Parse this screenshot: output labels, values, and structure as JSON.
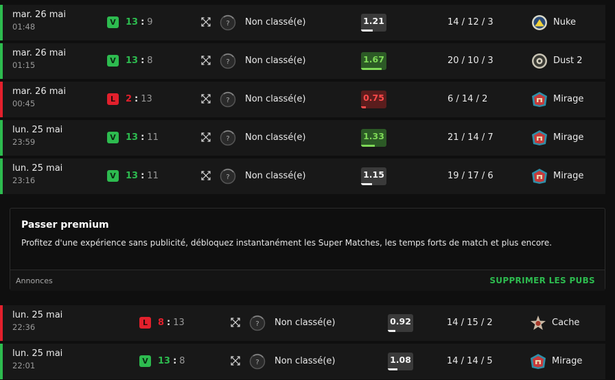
{
  "colors": {
    "win": "#2dbb4f",
    "loss": "#e2202c",
    "row_bg": "#181818",
    "page_bg": "#0f0f0f"
  },
  "matches_top": [
    {
      "date": "mar. 26 mai",
      "time": "01:48",
      "result": "V",
      "score_team": "13",
      "score_sep": ":",
      "score_opp": "9",
      "mode_icon": "crossed-arrows-icon",
      "rank_icon": "unranked-icon",
      "rank_label": "Non classé(e)",
      "rating": "1.21",
      "rating_fill": 0.45,
      "kda": "14 / 12 / 3",
      "map_icon": "nuke-icon",
      "map": "Nuke"
    },
    {
      "date": "mar. 26 mai",
      "time": "01:15",
      "result": "V",
      "score_team": "13",
      "score_sep": ":",
      "score_opp": "8",
      "mode_icon": "crossed-arrows-icon",
      "rank_icon": "unranked-icon",
      "rank_label": "Non classé(e)",
      "rating": "1.67",
      "rating_fill": 0.8,
      "kda": "20 / 10 / 3",
      "map_icon": "dust2-icon",
      "map": "Dust 2"
    },
    {
      "date": "mar. 26 mai",
      "time": "00:45",
      "result": "L",
      "score_team": "2",
      "score_sep": ":",
      "score_opp": "13",
      "mode_icon": "crossed-arrows-icon",
      "rank_icon": "unranked-icon",
      "rank_label": "Non classé(e)",
      "rating": "0.75",
      "rating_fill": 0.2,
      "kda": "6 / 14 / 2",
      "map_icon": "mirage-icon",
      "map": "Mirage"
    },
    {
      "date": "lun. 25 mai",
      "time": "23:59",
      "result": "V",
      "score_team": "13",
      "score_sep": ":",
      "score_opp": "11",
      "mode_icon": "crossed-arrows-icon",
      "rank_icon": "unranked-icon",
      "rank_label": "Non classé(e)",
      "rating": "1.33",
      "rating_fill": 0.55,
      "kda": "21 / 14 / 7",
      "map_icon": "mirage-icon",
      "map": "Mirage"
    },
    {
      "date": "lun. 25 mai",
      "time": "23:16",
      "result": "V",
      "score_team": "13",
      "score_sep": ":",
      "score_opp": "11",
      "mode_icon": "crossed-arrows-icon",
      "rank_icon": "unranked-icon",
      "rank_label": "Non classé(e)",
      "rating": "1.15",
      "rating_fill": 0.42,
      "kda": "19 / 17 / 6",
      "map_icon": "mirage-icon",
      "map": "Mirage"
    }
  ],
  "premium": {
    "title": "Passer premium",
    "text": "Profitez d'une expérience sans publicité, débloquez instantanément les Super Matches, les temps forts de match et plus encore.",
    "ads_label": "Annonces",
    "remove_ads": "SUPPRIMER LES PUBS"
  },
  "matches_bottom": [
    {
      "date": "lun. 25 mai",
      "time": "22:36",
      "result": "L",
      "score_team": "8",
      "score_sep": ":",
      "score_opp": "13",
      "mode_icon": "crossed-arrows-icon",
      "rank_icon": "unranked-icon",
      "rank_label": "Non classé(e)",
      "rating": "0.92",
      "rating_fill": 0.3,
      "kda": "14 / 15 / 2",
      "map_icon": "cache-icon",
      "map": "Cache"
    },
    {
      "date": "lun. 25 mai",
      "time": "22:01",
      "result": "V",
      "score_team": "13",
      "score_sep": ":",
      "score_opp": "8",
      "mode_icon": "crossed-arrows-icon",
      "rank_icon": "unranked-icon",
      "rank_label": "Non classé(e)",
      "rating": "1.08",
      "rating_fill": 0.38,
      "kda": "14 / 14 / 5",
      "map_icon": "mirage-icon",
      "map": "Mirage"
    }
  ]
}
